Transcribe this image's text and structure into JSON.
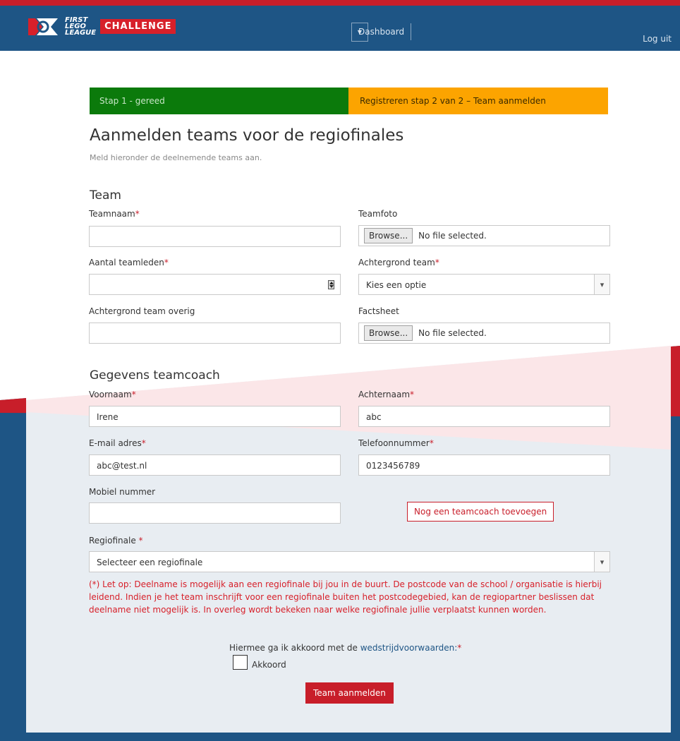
{
  "brand": {
    "logo_text": "FIRST LEGO LEAGUE",
    "challenge_badge": "CHALLENGE",
    "colors": {
      "navy": "#1e5585",
      "red": "#c81e2a",
      "green": "#0b7a0b",
      "orange": "#fca400"
    }
  },
  "nav": {
    "dashboard_label": "Dashboard",
    "logout_label": "Log uit"
  },
  "steps": {
    "step1": "Stap 1 - gereed",
    "step2": "Registreren stap 2 van 2 – Team aanmelden"
  },
  "page": {
    "title": "Aanmelden teams voor de regiofinales",
    "subtitle": "Meld hieronder de deelnemende teams aan."
  },
  "team_section": {
    "heading": "Team",
    "teamnaam_label": "Teamnaam",
    "teamfoto_label": "Teamfoto",
    "aantal_label": "Aantal teamleden",
    "achtergrond_label": "Achtergrond team",
    "achtergrond_overig_label": "Achtergrond team overig",
    "factsheet_label": "Factsheet",
    "browse_label": "Browse...",
    "no_file_label": "No file selected.",
    "achtergrond_selected": "Kies een optie",
    "teamnaam_value": "",
    "aantal_value": "",
    "achtergrond_overig_value": ""
  },
  "coach_section": {
    "heading": "Gegevens teamcoach",
    "voornaam_label": "Voornaam",
    "voornaam_value": "Irene",
    "achternaam_label": "Achternaam",
    "achternaam_value": "abc",
    "email_label": "E-mail adres",
    "email_value": "abc@test.nl",
    "telefoon_label": "Telefoonnummer",
    "telefoon_value": "0123456789",
    "mobiel_label": "Mobiel nummer",
    "mobiel_value": "",
    "add_coach_label": "Nog een teamcoach toevoegen"
  },
  "regio": {
    "label": "Regiofinale",
    "required_mark": "*",
    "selected": "Selecteer een regiofinale",
    "note": "(*) Let op: Deelname is mogelijk aan een regiofinale bij jou in de buurt. De postcode van de school / organisatie is hierbij leidend. Indien je het team inschrijft voor een regiofinale buiten het postcodegebied, kan de regiopartner beslissen dat deelname niet mogelijk is. In overleg wordt bekeken naar welke regiofinale jullie verplaatst kunnen worden."
  },
  "agreement": {
    "text": "Hiermee ga ik akkoord met de ",
    "link": "wedstrijdvoorwaarden:",
    "required_mark": "*",
    "checkbox_label": "Akkoord",
    "checked": false
  },
  "submit_label": "Team aanmelden",
  "required_mark": "*"
}
